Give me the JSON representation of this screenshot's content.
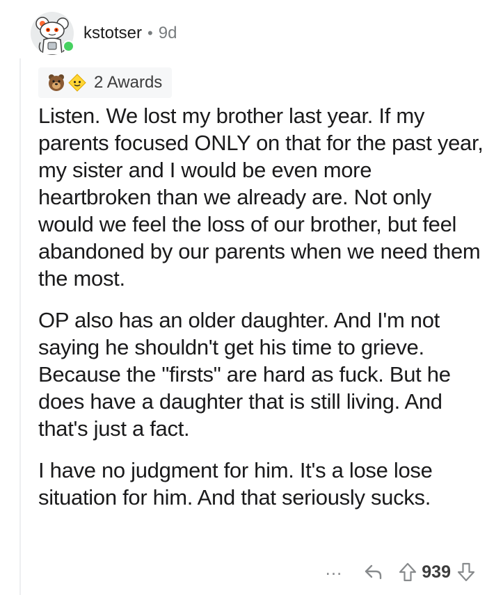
{
  "comment": {
    "author": "kstotser",
    "separator": "•",
    "age": "9d",
    "awards_label": "2 Awards",
    "paragraphs": [
      "Listen. We lost my brother last year. If my parents focused ONLY on that for the past year, my sister and I would be even more heartbroken than we already are. Not only would we feel the loss of our brother, but feel abandoned by our parents when we need them the most.",
      "OP also has an older daughter. And I'm not saying he shouldn't get his time to grieve. Because the \"firsts\" are hard as fuck. But he does have a daughter that is still living. And that's just a fact.",
      "I have no judgment for him. It's a lose lose situation for him. And that seriously sucks."
    ]
  },
  "actions": {
    "more_label": "...",
    "score": "939"
  },
  "icons": {
    "avatar": "snoo-avatar-icon",
    "online": "online-status-icon",
    "award_1": "bear-award-icon",
    "award_2": "wholesome-award-icon",
    "reply": "reply-arrow-icon",
    "upvote": "upvote-arrow-icon",
    "downvote": "downvote-arrow-icon"
  },
  "colors": {
    "text": "#1a1a1b",
    "muted": "#787c7e",
    "online": "#46d160",
    "awards_bg": "#f6f7f8",
    "thread_line": "#edeff1"
  }
}
